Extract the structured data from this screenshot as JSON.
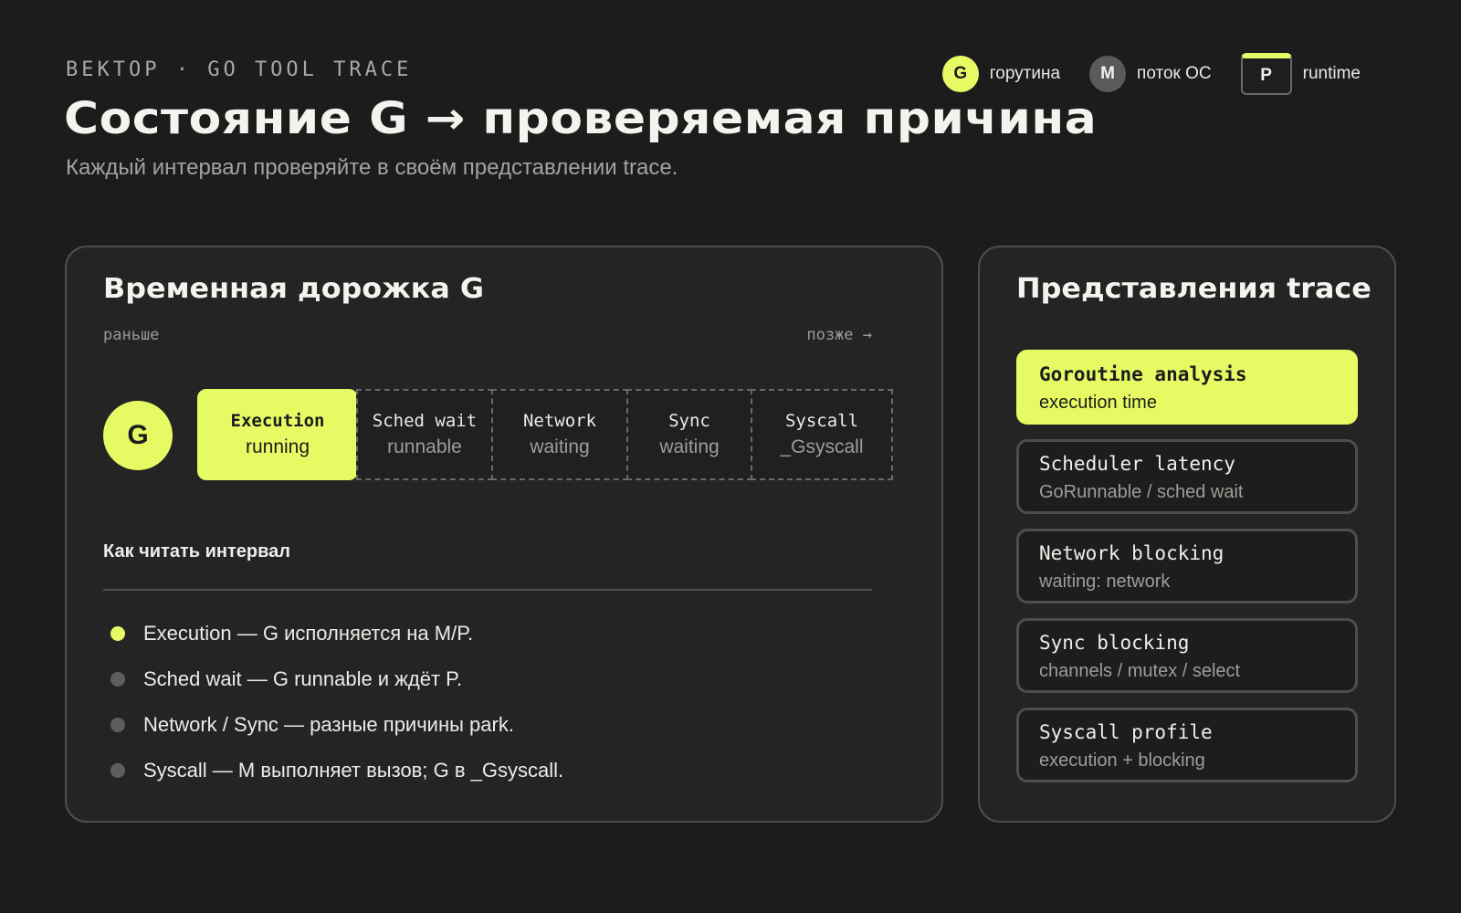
{
  "header": {
    "eyebrow": "ВЕКТОР · GO TOOL TRACE",
    "title": "Состояние G → проверяемая причина",
    "subtitle": "Каждый интервал проверяйте в своём представлении trace."
  },
  "legend": [
    {
      "glyph": "G",
      "label": "горутина"
    },
    {
      "glyph": "M",
      "label": "поток ОС"
    },
    {
      "glyph": "P",
      "label": "runtime"
    }
  ],
  "timeline_panel": {
    "title": "Временная дорожка G",
    "earlier_label": "раньше",
    "later_label": "позже →",
    "goroutine_glyph": "G",
    "segments": [
      {
        "name": "Execution",
        "state": "running",
        "highlighted": true
      },
      {
        "name": "Sched wait",
        "state": "runnable",
        "highlighted": false
      },
      {
        "name": "Network",
        "state": "waiting",
        "highlighted": false
      },
      {
        "name": "Sync",
        "state": "waiting",
        "highlighted": false
      },
      {
        "name": "Syscall",
        "state": "_Gsyscall",
        "highlighted": false
      }
    ],
    "howto_title": "Как читать интервал",
    "notes": [
      {
        "text": "Execution — G исполняется на M/P.",
        "highlighted": true
      },
      {
        "text": "Sched wait — G runnable и ждёт P.",
        "highlighted": false
      },
      {
        "text": "Network / Sync — разные причины park.",
        "highlighted": false
      },
      {
        "text": "Syscall — M выполняет вызов; G в _Gsyscall.",
        "highlighted": false
      }
    ]
  },
  "views_panel": {
    "title": "Представления trace",
    "views": [
      {
        "name": "Goroutine analysis",
        "detail": "execution time",
        "active": true
      },
      {
        "name": "Scheduler latency",
        "detail": "GoRunnable / sched wait",
        "active": false
      },
      {
        "name": "Network blocking",
        "detail": "waiting: network",
        "active": false
      },
      {
        "name": "Sync blocking",
        "detail": "channels / mutex / select",
        "active": false
      },
      {
        "name": "Syscall profile",
        "detail": "execution + blocking",
        "active": false
      }
    ]
  },
  "colors": {
    "accent": "#e6fb63",
    "background": "#1c1c1c",
    "panel": "#242424",
    "border": "#4e4e4e"
  }
}
